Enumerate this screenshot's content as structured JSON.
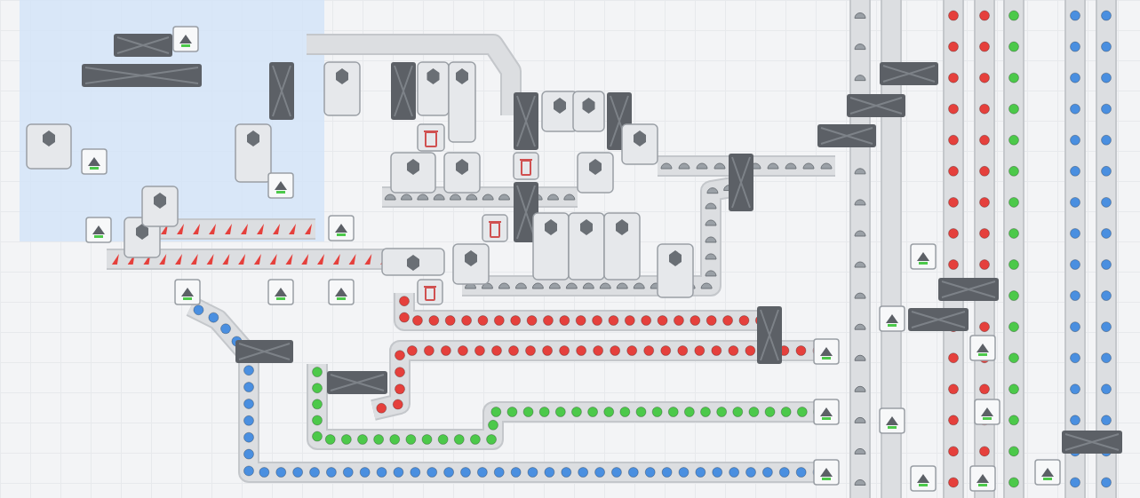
{
  "zone": {
    "highlighted": true,
    "color": "#d3e4f8"
  },
  "belts": [
    {
      "item": "wedge",
      "color": "#e5403c",
      "count": 10
    },
    {
      "item": "wedge",
      "color": "#e5403c",
      "count": 18
    },
    {
      "item": "circle",
      "color": "#e5403c",
      "count": 24
    },
    {
      "item": "circle",
      "color": "#e5403c",
      "count": 30
    },
    {
      "item": "circle",
      "color": "#4cc94a",
      "count": 38
    },
    {
      "item": "circle",
      "color": "#4a8fe0",
      "count": 46
    },
    {
      "item": "half",
      "color": "#9aa0a6",
      "count": 12
    },
    {
      "item": "half",
      "color": "#9aa0a6",
      "count": 10
    },
    {
      "item": "half",
      "color": "#9aa0a6",
      "count": 22
    },
    {
      "item": "half",
      "color": "#9aa0a6",
      "count": 16
    },
    {
      "item": "circle",
      "color": "#e5403c",
      "count": 16
    },
    {
      "item": "circle",
      "color": "#e5403c",
      "count": 16
    },
    {
      "item": "circle",
      "color": "#4cc94a",
      "count": 16
    },
    {
      "item": "circle",
      "color": "#4a8fe0",
      "count": 16
    },
    {
      "item": "circle",
      "color": "#4a8fe0",
      "count": 16
    },
    {
      "item": "none",
      "color": "#9aa0a6",
      "count": 0
    },
    {
      "item": "none",
      "color": "#9aa0a6",
      "count": 0
    }
  ],
  "buildings": [
    {
      "kind": "balancer"
    },
    {
      "kind": "balancer"
    },
    {
      "kind": "balancer"
    },
    {
      "kind": "balancer"
    },
    {
      "kind": "balancer"
    },
    {
      "kind": "balancer"
    },
    {
      "kind": "balancer"
    },
    {
      "kind": "balancer"
    },
    {
      "kind": "balancer"
    },
    {
      "kind": "balancer"
    },
    {
      "kind": "balancer"
    },
    {
      "kind": "balancer"
    },
    {
      "kind": "balancer"
    },
    {
      "kind": "balancer"
    },
    {
      "kind": "balancer"
    },
    {
      "kind": "balancer"
    },
    {
      "kind": "balancer"
    },
    {
      "kind": "machine"
    },
    {
      "kind": "machine"
    },
    {
      "kind": "machine"
    },
    {
      "kind": "machine"
    },
    {
      "kind": "machine"
    },
    {
      "kind": "machine"
    },
    {
      "kind": "machine"
    },
    {
      "kind": "machine"
    },
    {
      "kind": "machine"
    },
    {
      "kind": "machine"
    },
    {
      "kind": "machine"
    },
    {
      "kind": "machine"
    },
    {
      "kind": "machine"
    },
    {
      "kind": "machine"
    },
    {
      "kind": "machine"
    },
    {
      "kind": "machine"
    },
    {
      "kind": "machine"
    },
    {
      "kind": "machine"
    },
    {
      "kind": "machine"
    },
    {
      "kind": "trash"
    },
    {
      "kind": "trash"
    },
    {
      "kind": "trash"
    },
    {
      "kind": "trash"
    },
    {
      "kind": "port"
    },
    {
      "kind": "port"
    },
    {
      "kind": "port"
    },
    {
      "kind": "port"
    },
    {
      "kind": "port"
    },
    {
      "kind": "port"
    },
    {
      "kind": "port"
    },
    {
      "kind": "port"
    },
    {
      "kind": "port"
    },
    {
      "kind": "port"
    },
    {
      "kind": "port"
    },
    {
      "kind": "port"
    },
    {
      "kind": "port"
    },
    {
      "kind": "port"
    },
    {
      "kind": "port"
    },
    {
      "kind": "port"
    },
    {
      "kind": "port"
    },
    {
      "kind": "port"
    },
    {
      "kind": "port"
    }
  ]
}
